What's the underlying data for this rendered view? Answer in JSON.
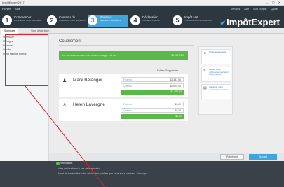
{
  "window": {
    "title": "ImpôtExpert 2017",
    "controls": "—  ▢  ✕"
  },
  "menu": [
    "Fichier",
    "Aide"
  ],
  "utility": [
    "Services",
    "Aide",
    "Mon compte",
    "Quitter"
  ],
  "steps": [
    {
      "num": "1",
      "label": "Commencer",
      "sub": "Commencer votre déclaration"
    },
    {
      "num": "2",
      "label": "Contenu du",
      "sub": "Contenu de votre déclaration"
    },
    {
      "num": "3",
      "label": "Revenus",
      "sub": "Revenus et déductions",
      "active": true
    },
    {
      "num": "4",
      "label": "Déclaration",
      "sub": "Vérifier et imprimer"
    },
    {
      "num": "5",
      "label": "Impôt Net",
      "sub": "Transmettre votre déclaration"
    }
  ],
  "logo": {
    "check": "✔",
    "text": "ImpôtExpert"
  },
  "tabs": [
    "Sommaire",
    "Votre déclaration"
  ],
  "sidebar": [
    "Sommaire",
    "Ménages",
    "Revenus",
    "Crédits",
    "Impôt minimal fédéral"
  ],
  "page_title": "Couplement",
  "banner": {
    "text": "Le remboursement de votre ménage est de",
    "value": "$2 457,00"
  },
  "toolbar": {
    "edit": "Éditer",
    "delete": "Supprimer"
  },
  "people": [
    {
      "name": "Mark Bélanger",
      "rows": [
        {
          "label": "Fédéral",
          "value": "$2 387,50"
        },
        {
          "label": "Québec",
          "value": "$2 020,00"
        }
      ],
      "total": "$4 407,50"
    },
    {
      "name": "Helen Lavergne",
      "rows": [
        {
          "label": "Fédéral",
          "value": "$0,00"
        },
        {
          "label": "Québec",
          "value": "$0,00"
        }
      ],
      "total": "$0,00"
    }
  ],
  "rpanel": [
    {
      "icon": "★",
      "text": "Changer d'entente"
    },
    {
      "icon": "✎",
      "text": "Ajuster votre remboursement pour votre conjoint"
    },
    {
      "icon": "▤",
      "text": "Visionner votre déclaration complète"
    }
  ],
  "actions": {
    "prev": "Précédent",
    "next": "Suivant"
  },
  "bottom": {
    "header": "Vérification",
    "lines": [
      {
        "text": "Votre déclaration n'a pas de diagnostic.",
        "link": ""
      },
      {
        "text": "Avant de transmettre votre déclaration, vérifiez que vous avez tout saisi.",
        "link": "Message"
      }
    ]
  },
  "colors": {
    "accent": "#3ea6dc",
    "success": "#59b847",
    "highlight": "#e0202c",
    "dark": "#2d3740"
  }
}
